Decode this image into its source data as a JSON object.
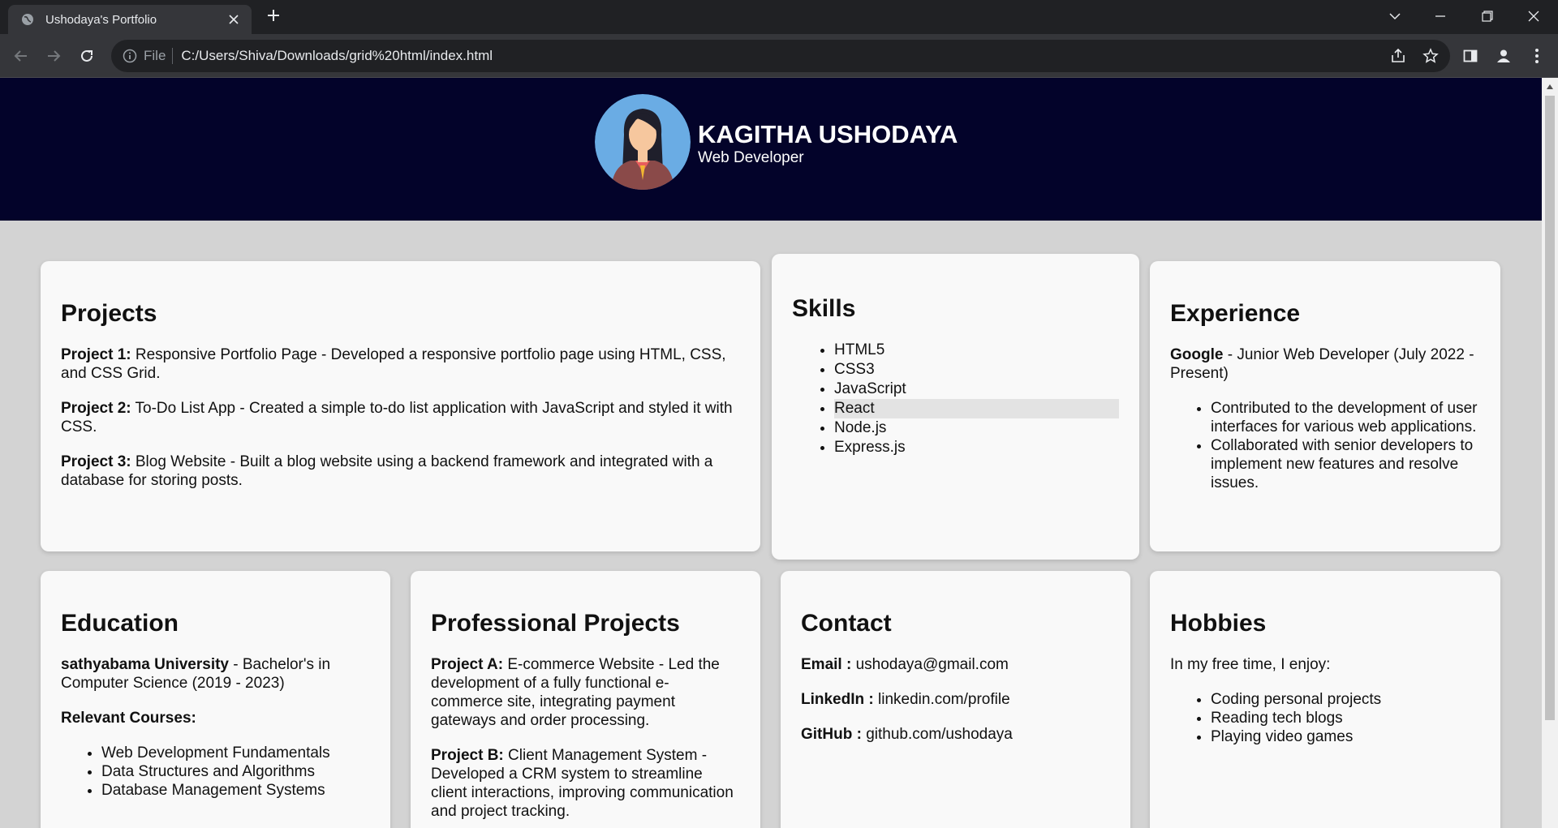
{
  "browser": {
    "tab_title": "Ushodaya's Portfolio",
    "scheme_label": "File",
    "url": "C:/Users/Shiva/Downloads/grid%20html/index.html"
  },
  "header": {
    "name": "KAGITHA USHODAYA",
    "role": "Web Developer"
  },
  "projects": {
    "title": "Projects",
    "items": [
      {
        "label": "Project 1:",
        "text": " Responsive Portfolio Page - Developed a responsive portfolio page using HTML, CSS, and CSS Grid."
      },
      {
        "label": "Project 2:",
        "text": " To-Do List App - Created a simple to-do list application with JavaScript and styled it with CSS."
      },
      {
        "label": "Project 3:",
        "text": " Blog Website - Built a blog website using a backend framework and integrated with a database for storing posts."
      }
    ]
  },
  "skills": {
    "title": "Skills",
    "items": [
      "HTML5",
      "CSS3",
      "JavaScript",
      "React",
      "Node.js",
      "Express.js"
    ]
  },
  "experience": {
    "title": "Experience",
    "company": "Google",
    "position": " - Junior Web Developer (July 2022 - Present)",
    "items": [
      "Contributed to the development of user interfaces for various web applications.",
      "Collaborated with senior developers to implement new features and resolve issues."
    ]
  },
  "education": {
    "title": "Education",
    "school": "sathyabama University",
    "degree": " - Bachelor's in Computer Science (2019 - 2023)",
    "courses_label": "Relevant Courses:",
    "courses": [
      "Web Development Fundamentals",
      "Data Structures and Algorithms",
      "Database Management Systems"
    ]
  },
  "professional": {
    "title": "Professional Projects",
    "items": [
      {
        "label": "Project A:",
        "text": " E-commerce Website - Led the development of a fully functional e-commerce site, integrating payment gateways and order processing."
      },
      {
        "label": "Project B:",
        "text": " Client Management System - Developed a CRM system to streamline client interactions, improving communication and project tracking."
      }
    ]
  },
  "contact": {
    "title": "Contact",
    "email_label": "Email :",
    "email": " ushodaya@gmail.com",
    "linkedin_label": "LinkedIn :",
    "linkedin": " linkedin.com/profile",
    "github_label": "GitHub :",
    "github": " github.com/ushodaya"
  },
  "hobbies": {
    "title": "Hobbies",
    "intro": "In my free time, I enjoy:",
    "items": [
      "Coding personal projects",
      "Reading tech blogs",
      "Playing video games"
    ]
  }
}
